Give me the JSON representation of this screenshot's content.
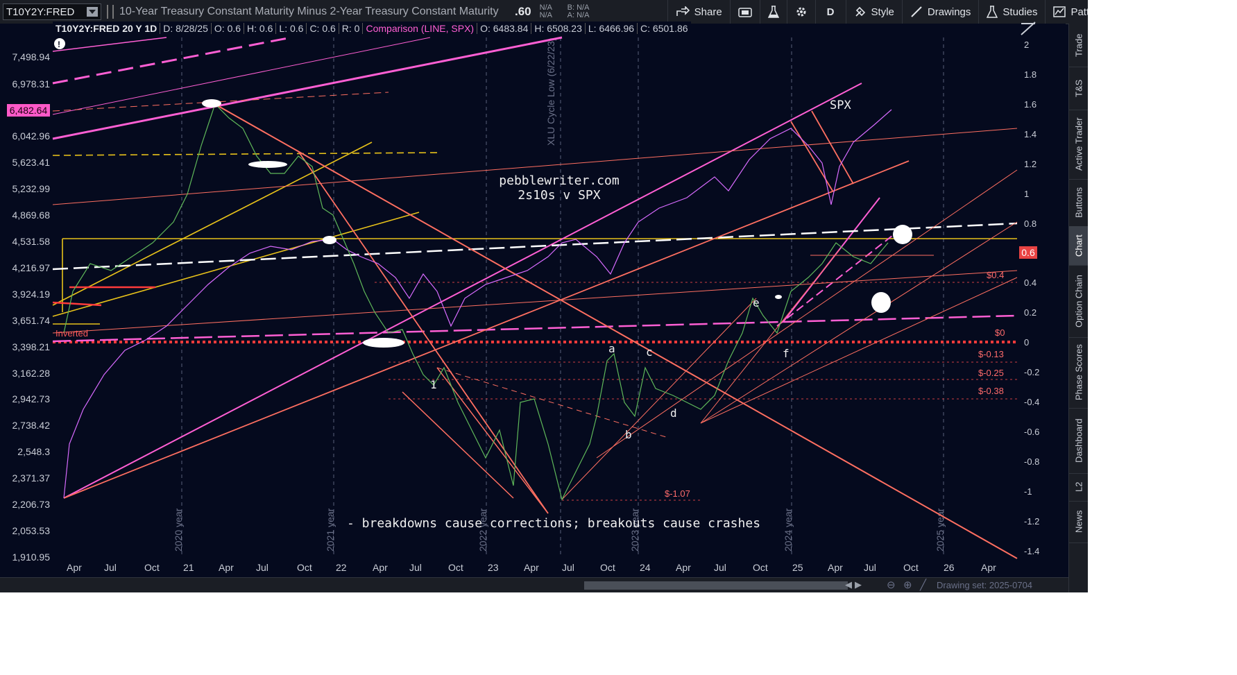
{
  "toolbar": {
    "symbol": "T10Y2Y:FRED",
    "description": "10-Year Treasury Constant Maturity Minus 2-Year Treasury Constant Maturity",
    "last": ".60",
    "bid_ask": [
      "N/A",
      "N/A",
      "B: N/A",
      "A: N/A"
    ],
    "share": "Share",
    "period": "D",
    "style": "Style",
    "drawings": "Drawings",
    "studies": "Studies",
    "patterns": "Patterns"
  },
  "infobar": {
    "symbol_period": "T10Y2Y:FRED 20 Y 1D",
    "date": "D: 8/28/25",
    "open": "O: 0.6",
    "high": "H: 0.6",
    "low": "L: 0.6",
    "close": "C: 0.6",
    "r": "R: 0",
    "comparison": "Comparison (LINE, SPX)",
    "c_open": "O: 6483.84",
    "c_high": "H: 6508.23",
    "c_low": "L: 6466.96",
    "c_close": "C: 6501.86"
  },
  "left_axis": [
    "7,498.94",
    "6,978.31",
    "6,042.96",
    "5,623.41",
    "5,232.99",
    "4,869.68",
    "4,531.58",
    "4,216.97",
    "3,924.19",
    "3,651.74",
    "3,398.21",
    "3,162.28",
    "2,942.73",
    "2,738.42",
    "2,548.3",
    "2,371.37",
    "2,206.73",
    "2,053.53",
    "1,910.95"
  ],
  "left_tag": "6,482.64",
  "right_axis": [
    "2",
    "1.8",
    "1.6",
    "1.4",
    "1.2",
    "1",
    "0.8",
    "0.6",
    "0.4",
    "0.2",
    "0",
    "-0.2",
    "-0.4",
    "-0.6",
    "-0.8",
    "-1",
    "-1.2",
    "-1.4"
  ],
  "right_tag": "0.6",
  "x_axis": [
    "Apr",
    "Jul",
    "Oct",
    "21",
    "Apr",
    "Jul",
    "Oct",
    "22",
    "Apr",
    "Jul",
    "Oct",
    "23",
    "Apr",
    "Jul",
    "Oct",
    "24",
    "Apr",
    "Jul",
    "Oct",
    "25",
    "Apr",
    "Jul",
    "Oct",
    "26",
    "Apr"
  ],
  "year_markers": [
    "2020 year",
    "2021 year",
    "2022 year",
    "2023 year",
    "2024 year",
    "2025 year"
  ],
  "xlu_label": "XLU Cycle Low (6/22/23)",
  "title_lines": [
    "pebblewriter.com",
    "2s10s v SPX"
  ],
  "spx_label": "SPX",
  "inverted_label": "Inverted",
  "level_labels": [
    "$0.4",
    "$0",
    "$-0.13",
    "$-0.25",
    "$-0.38",
    "$-1.07"
  ],
  "wave_labels": [
    "a",
    "b",
    "c",
    "d",
    "e",
    "f",
    "1"
  ],
  "footer_note": "- breakdowns cause corrections; breakouts cause crashes",
  "side_tabs": [
    "Trade",
    "T&S",
    "Active Trader",
    "Buttons",
    "Chart",
    "Option Chain",
    "Phase Scores",
    "Dashboard",
    "L2",
    "News"
  ],
  "drawing_set": "Drawing set: 2025-0704",
  "colors": {
    "spx": "#d86bff",
    "yield": "#5fb85a",
    "pink": "#ff5fd4",
    "salmon": "#ff6f61",
    "yellow": "#e8c21a",
    "red": "#ff3b3b"
  }
}
